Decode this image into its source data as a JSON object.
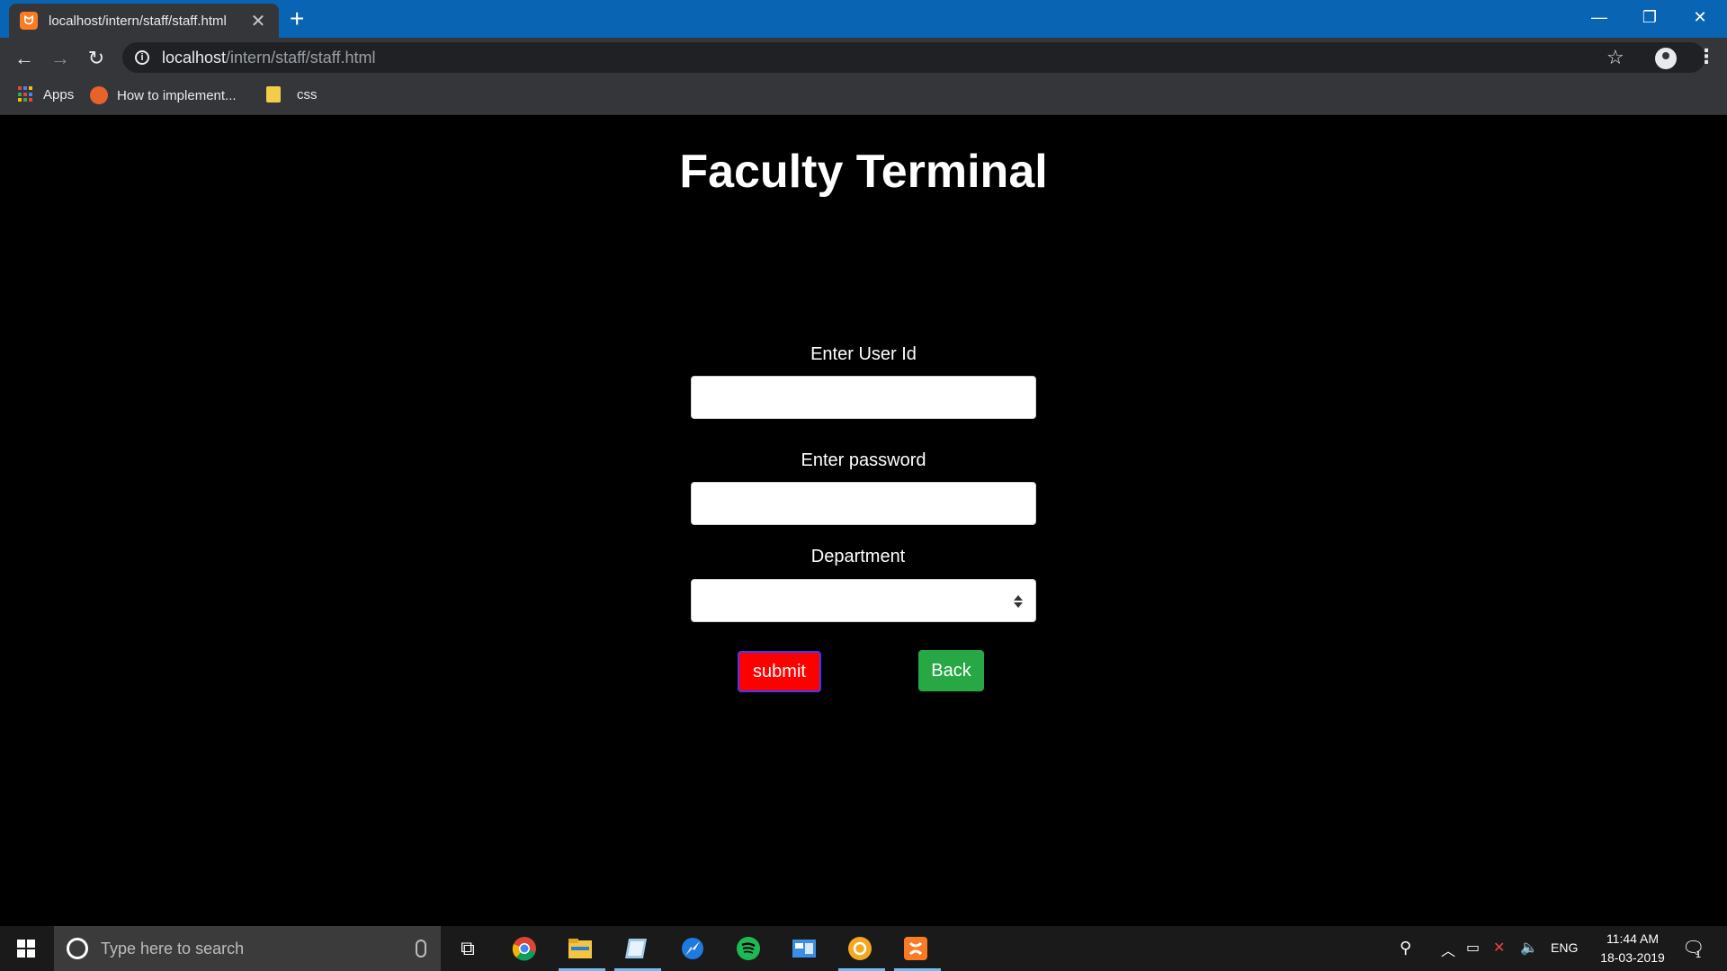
{
  "browser": {
    "tab_title": "localhost/intern/staff/staff.html",
    "tab_close": "✕",
    "new_tab": "+",
    "url_host": "localhost",
    "url_path": "/intern/staff/staff.html",
    "bookmarks": [
      {
        "label": "Apps",
        "icon": "apps-grid-icon"
      },
      {
        "label": "How to implement...",
        "icon": "orange-site-icon"
      },
      {
        "label": "css",
        "icon": "folder-icon"
      }
    ]
  },
  "page": {
    "title": "Faculty Terminal",
    "user_id_label": "Enter User Id",
    "user_id_value": "",
    "password_label": "Enter password",
    "password_value": "",
    "department_label": "Department",
    "department_value": "",
    "submit_label": "submit",
    "back_label": "Back"
  },
  "taskbar": {
    "search_placeholder": "Type here to search",
    "language": "ENG",
    "time": "11:44 AM",
    "date": "18-03-2019",
    "notification_count": "1"
  },
  "colors": {
    "titlebar": "#0a64b4",
    "submit_bg": "#ff0000",
    "back_bg": "#28a745"
  }
}
